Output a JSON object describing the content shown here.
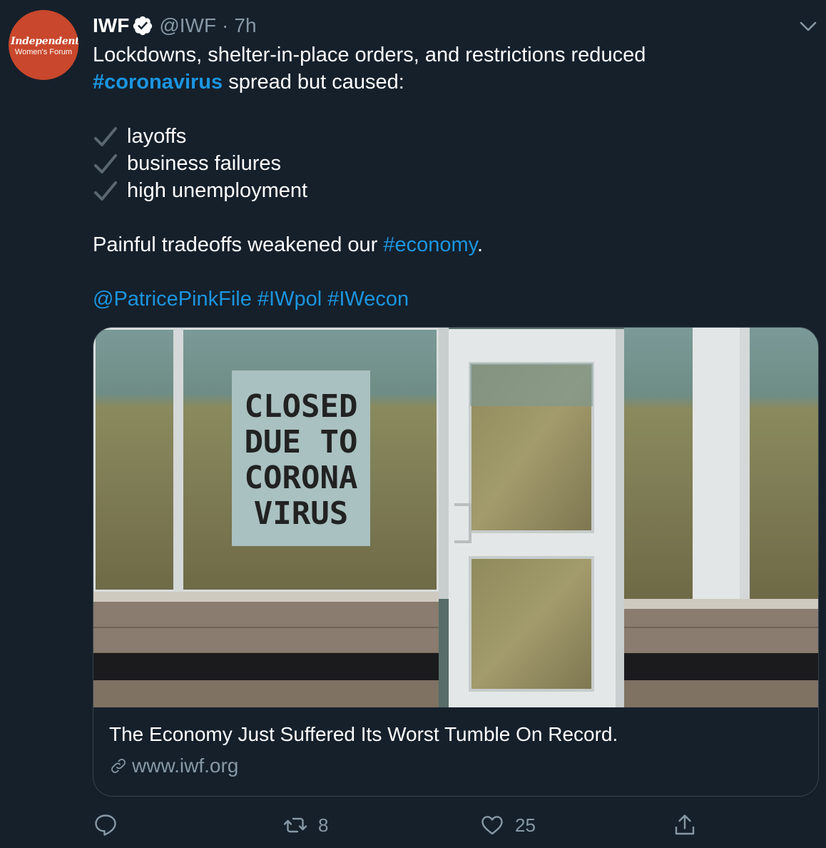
{
  "tweet": {
    "author_name": "IWF",
    "handle": "@IWF",
    "separator": "·",
    "time": "7h",
    "avatar_logo_line1": "Independent",
    "avatar_logo_line2": "Women's Forum",
    "text": {
      "line1": "Lockdowns, shelter-in-place orders, and restrictions reduced",
      "line2_hashtag": "#coronavirus",
      "line2_rest": " spread but caused:",
      "checklist": [
        "layoffs",
        "business failures",
        "high unemployment"
      ],
      "line_economy_pre": "Painful tradeoffs weakened our ",
      "line_economy_hashtag": "#economy",
      "line_economy_post": ".",
      "mention": "@PatricePinkFile",
      "hashtag_iwpol": "#IWpol",
      "hashtag_iwecon": "#IWecon"
    },
    "card": {
      "sign_lines": [
        "CLOSED",
        "DUE TO",
        "CORONA",
        "VIRUS"
      ],
      "title": "The Economy Just Suffered Its Worst Tumble On Record.",
      "url": "www.iwf.org"
    },
    "actions": {
      "reply_icon": "reply-icon",
      "retweet_icon": "retweet-icon",
      "retweet_count": "8",
      "like_icon": "heart-icon",
      "like_count": "25",
      "share_icon": "share-icon"
    }
  },
  "colors": {
    "background": "#15202b",
    "link": "#1b95e0",
    "muted": "#8899a6",
    "avatar": "#c9472c"
  }
}
